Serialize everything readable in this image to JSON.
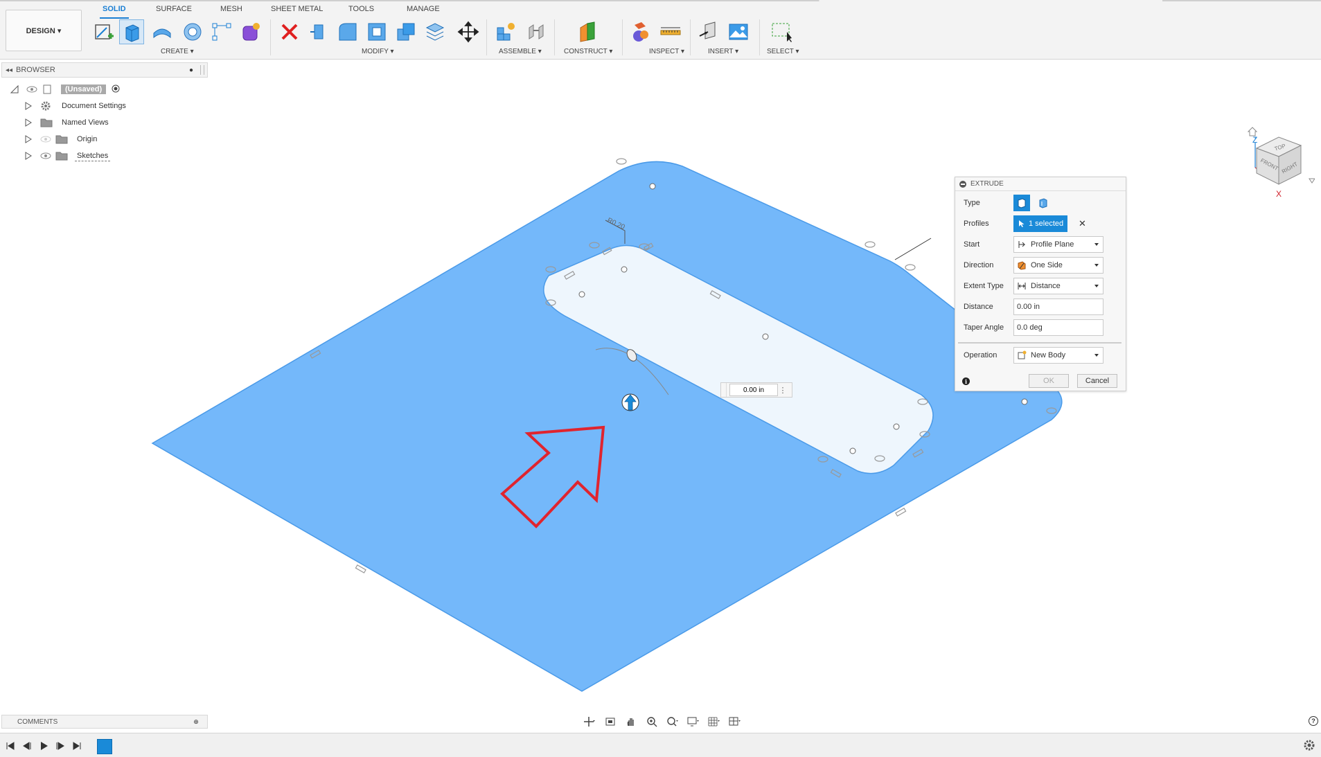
{
  "toolbar": {
    "design_label": "DESIGN ▾",
    "tabs": [
      "SOLID",
      "SURFACE",
      "MESH",
      "SHEET METAL",
      "TOOLS",
      "MANAGE"
    ],
    "groups": {
      "create": "CREATE ▾",
      "modify": "MODIFY ▾",
      "assemble": "ASSEMBLE ▾",
      "construct": "CONSTRUCT ▾",
      "inspect": "INSPECT ▾",
      "insert": "INSERT ▾",
      "select": "SELECT ▾"
    }
  },
  "browser": {
    "title": "BROWSER",
    "items": [
      {
        "label": "(Unsaved)"
      },
      {
        "label": "Document Settings"
      },
      {
        "label": "Named Views"
      },
      {
        "label": "Origin"
      },
      {
        "label": "Sketches"
      }
    ]
  },
  "extrude": {
    "title": "EXTRUDE",
    "rows": {
      "type": "Type",
      "profiles": "Profiles",
      "start": "Start",
      "direction": "Direction",
      "extent_type": "Extent Type",
      "distance": "Distance",
      "taper_angle": "Taper Angle",
      "operation": "Operation"
    },
    "profiles_value": "1 selected",
    "start_value": "Profile Plane",
    "direction_value": "One Side",
    "extent_value": "Distance",
    "distance_value": "0.00 in",
    "taper_value": "0.0 deg",
    "operation_value": "New Body",
    "ok_label": "OK",
    "cancel_label": "Cancel"
  },
  "canvas": {
    "distance_input": "0.00 in",
    "dimension_label": "R0.20"
  },
  "viewcube": {
    "top": "TOP",
    "front": "FRONT",
    "right": "RIGHT",
    "axis_z": "Z",
    "axis_x": "X"
  },
  "comments": {
    "title": "COMMENTS"
  },
  "colors": {
    "plate": "#74b8fa",
    "accent": "#1a8ad8",
    "arrow": "#e0242e"
  }
}
